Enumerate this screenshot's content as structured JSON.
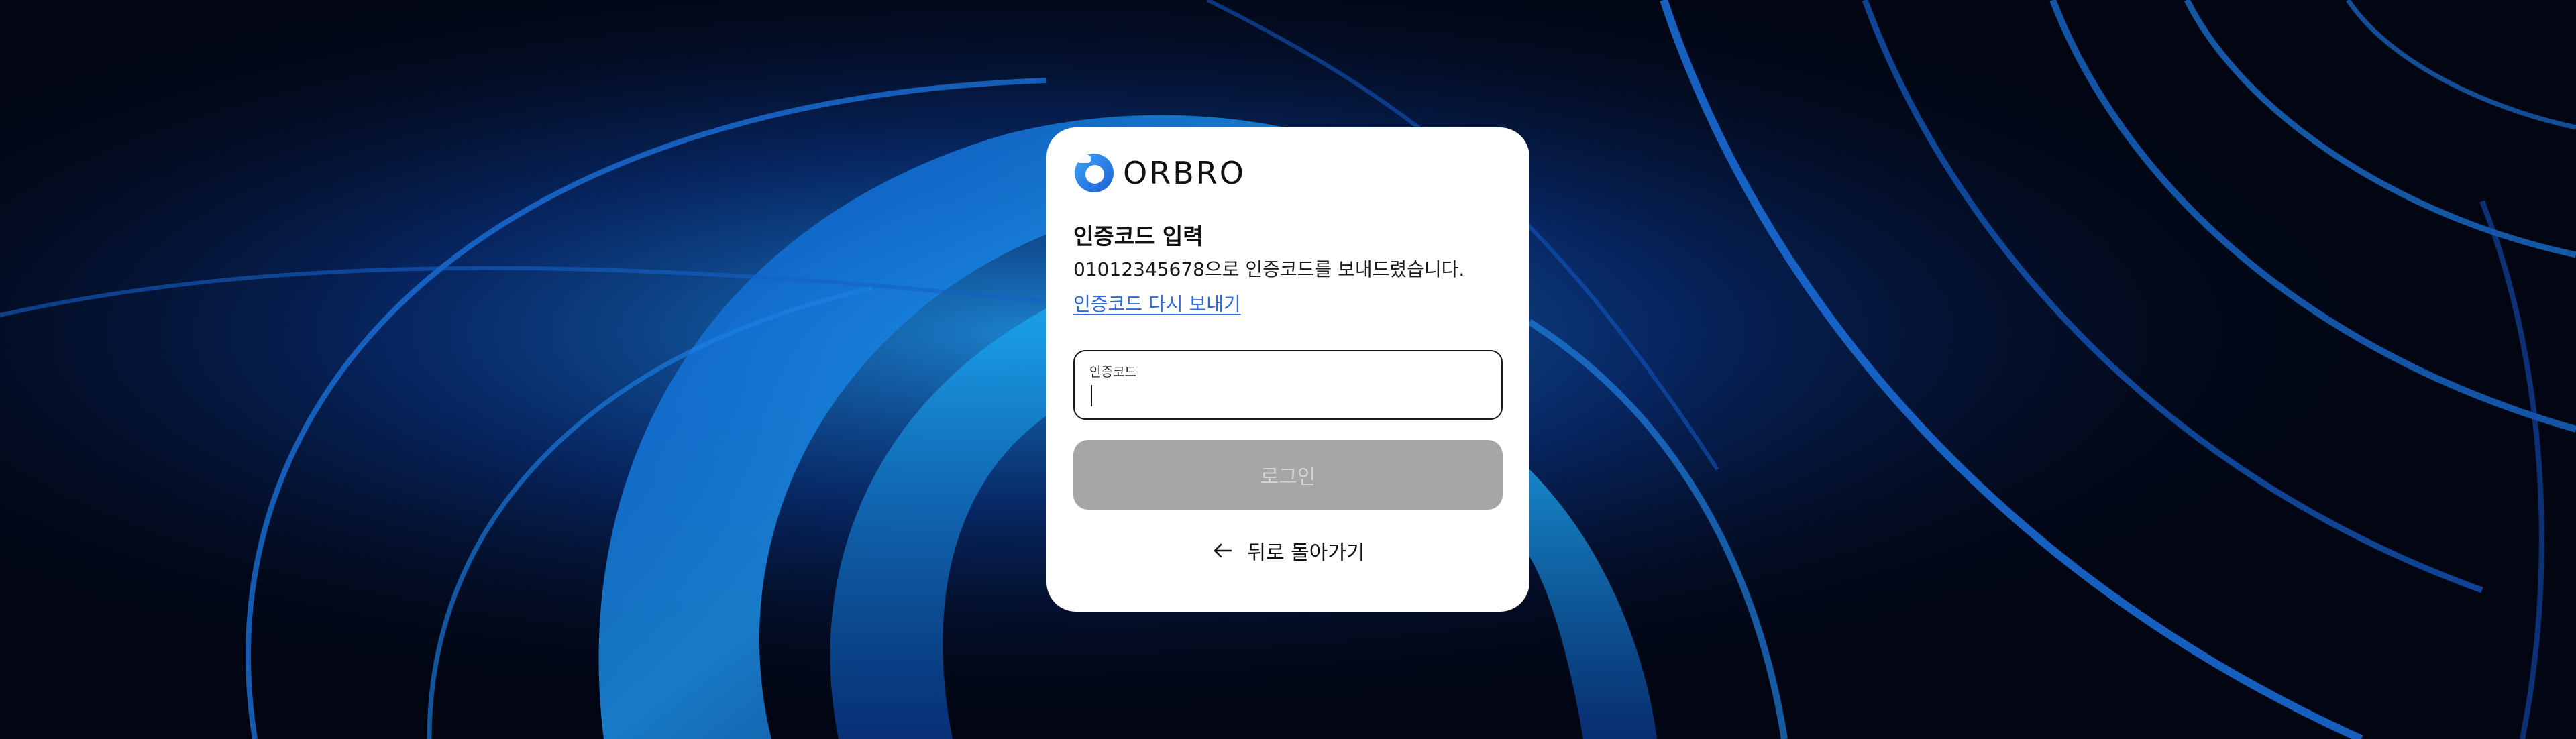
{
  "brand": {
    "name": "ORBRO",
    "accent": "#2f6bdc"
  },
  "auth": {
    "title": "인증코드 입력",
    "description": "01012345678으로 인증코드를 보내드렸습니다.",
    "resend_link": "인증코드 다시 보내기",
    "code_field": {
      "label": "인증코드",
      "value": "",
      "placeholder": ""
    },
    "login_button": "로그인",
    "back_link": "뒤로 돌아가기"
  },
  "icons": {
    "logo": "orbro-logo-icon",
    "back": "arrow-left-icon"
  },
  "colors": {
    "background": "#020613",
    "card": "#ffffff",
    "button_disabled": "#a6a6a6",
    "link": "#2f6bdc"
  }
}
